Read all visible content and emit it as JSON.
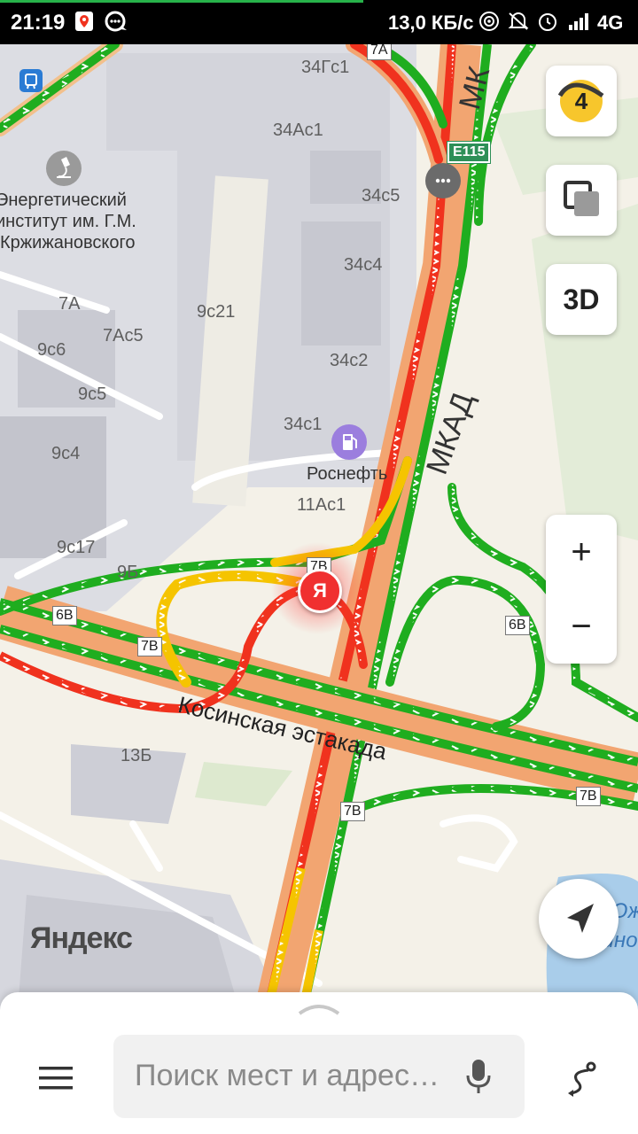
{
  "status_bar": {
    "time": "21:19",
    "speed": "13,0 КБ/с",
    "network": "4G",
    "icons": [
      "maps-pin-icon",
      "chat-icon",
      "hotspot-icon",
      "mute-icon",
      "alarm-icon",
      "signal-icon"
    ]
  },
  "map": {
    "highway_label": "МКАД",
    "highway_label_top": "МК",
    "road_label": "Косинская эстакада",
    "route_shield": "E115",
    "brand": "Яндекс",
    "location_marker": "Я",
    "institute": [
      "Энергетический",
      "институт им. Г.М.",
      "Кржижановского"
    ],
    "poi_fuel": "Роснефть",
    "lake_label": [
      "Юж",
      "Выхино"
    ],
    "exit_shields": [
      "7А",
      "7В",
      "6В",
      "7В",
      "6В",
      "7В",
      "7В"
    ],
    "building_numbers": [
      "34Гс1",
      "34Ас1",
      "34с5",
      "34с4",
      "34с2",
      "34с1",
      "11Ас1",
      "9с21",
      "7А",
      "7Ас5",
      "9с6",
      "9с5",
      "9с4",
      "9с17",
      "9Б",
      "13Б"
    ],
    "traffic_colors": {
      "free": "#1fad1f",
      "slow": "#f5c400",
      "jam": "#f0321e"
    }
  },
  "controls": {
    "traffic_level": "4",
    "layers_icon": "layers-icon",
    "label_3d": "3D",
    "zoom_in": "+",
    "zoom_out": "−"
  },
  "bottom_bar": {
    "search_placeholder": "Поиск мест и адрес…",
    "menu_icon": "menu-icon",
    "mic_icon": "microphone-icon",
    "route_icon": "route-icon"
  }
}
